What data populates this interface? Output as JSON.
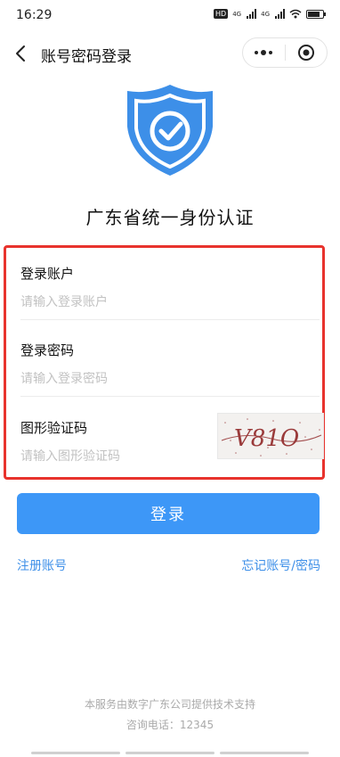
{
  "status_bar": {
    "time": "16:29",
    "hd_label": "HD",
    "network_1": "4G",
    "network_2": "4G",
    "battery_level": 0.8
  },
  "nav": {
    "back_icon": "chevron-left-icon",
    "title": "账号密码登录",
    "more_icon": "more-dots-icon",
    "close_icon": "target-close-icon"
  },
  "header": {
    "logo_icon": "shield-check-icon",
    "title": "广东省统一身份认证"
  },
  "form": {
    "account": {
      "label": "登录账户",
      "placeholder": "请输入登录账户",
      "value": ""
    },
    "password": {
      "label": "登录密码",
      "placeholder": "请输入登录密码",
      "value": ""
    },
    "captcha": {
      "label": "图形验证码",
      "placeholder": "请输入图形验证码",
      "value": "",
      "image_text": "V81O"
    }
  },
  "actions": {
    "login_label": "登录",
    "register_label": "注册账号",
    "forgot_label": "忘记账号/密码"
  },
  "footer": {
    "line1": "本服务由数字广东公司提供技术支持",
    "line2": "咨询电话：12345"
  },
  "colors": {
    "accent": "#3d97f7",
    "highlight_border": "#e8332d",
    "link": "#3d8fe8"
  }
}
